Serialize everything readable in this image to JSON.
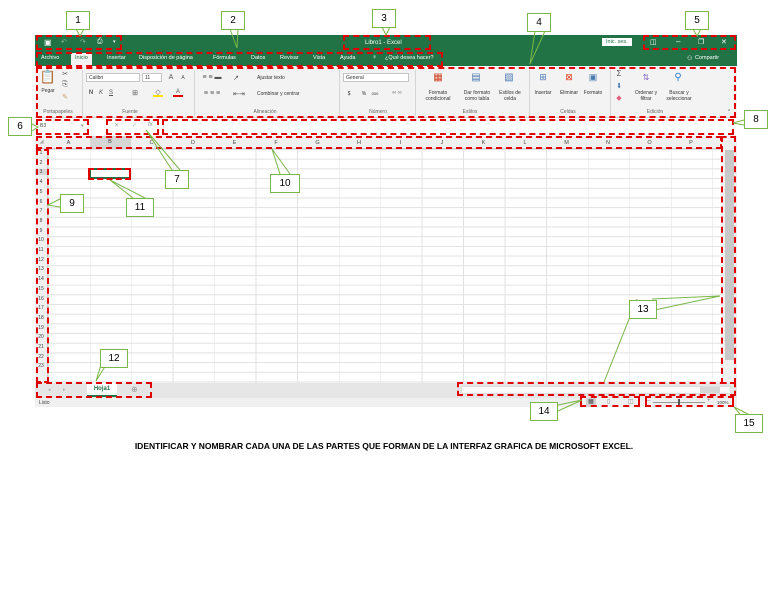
{
  "excel": {
    "window_title": "Libro1 - Excel",
    "signin": "Inic. ses.",
    "share": "Compartir",
    "tabs": [
      "Archivo",
      "Inicio",
      "Insertar",
      "Disposición de página",
      "Fórmulas",
      "Datos",
      "Revisar",
      "Vista",
      "Ayuda"
    ],
    "tell_me": "¿Qué desea hacer?",
    "ribbon": {
      "clipboard": {
        "paste": "Pegar",
        "group": "Portapapeles"
      },
      "font": {
        "name": "Calibri",
        "size": "11",
        "bold": "N",
        "italic": "K",
        "underline": "S",
        "group": "Fuente"
      },
      "alignment": {
        "wrap": "Ajustar texto",
        "merge": "Combinar y centrar",
        "group": "Alineación"
      },
      "number": {
        "format": "General",
        "currency": "$",
        "percent": "%",
        "thousands": "000",
        "group": "Número"
      },
      "styles": {
        "conditional": [
          "Formato",
          "condicional"
        ],
        "table": [
          "Dar formato",
          "como tabla"
        ],
        "cell": [
          "Estilos de",
          "celda"
        ],
        "group": "Estilos"
      },
      "cells": {
        "insert": "Insertar",
        "delete": "Eliminar",
        "format": "Formato",
        "group": "Celdas"
      },
      "editing": {
        "sort": [
          "Ordenar y",
          "filtrar"
        ],
        "find": [
          "Buscar y",
          "seleccionar"
        ],
        "group": "Edición"
      }
    },
    "name_box": "B3",
    "columns": [
      "A",
      "B",
      "C",
      "D",
      "E",
      "F",
      "G",
      "H",
      "I",
      "J",
      "K",
      "L",
      "M",
      "N",
      "O",
      "P"
    ],
    "rows": [
      "1",
      "2",
      "3",
      "4",
      "5",
      "6",
      "7",
      "8",
      "9",
      "10",
      "11",
      "12",
      "13",
      "14",
      "15",
      "16",
      "17",
      "18",
      "19",
      "20",
      "21",
      "22",
      "23"
    ],
    "sheet_tab": "Hoja1",
    "status": "Listo",
    "zoom": "100%"
  },
  "callouts": [
    "1",
    "2",
    "3",
    "4",
    "5",
    "6",
    "7",
    "8",
    "9",
    "10",
    "11",
    "12",
    "13",
    "14",
    "15"
  ],
  "caption": "IDENTIFICAR Y NOMBRAR CADA UNA DE LAS PARTES QUE FORMAN DE LA INTERFAZ GRAFICA DE MICROSOFT EXCEL.",
  "colors": {
    "excel_green": "#217346",
    "dashed_red": "#e00000",
    "callout_green": "#7ab648"
  }
}
